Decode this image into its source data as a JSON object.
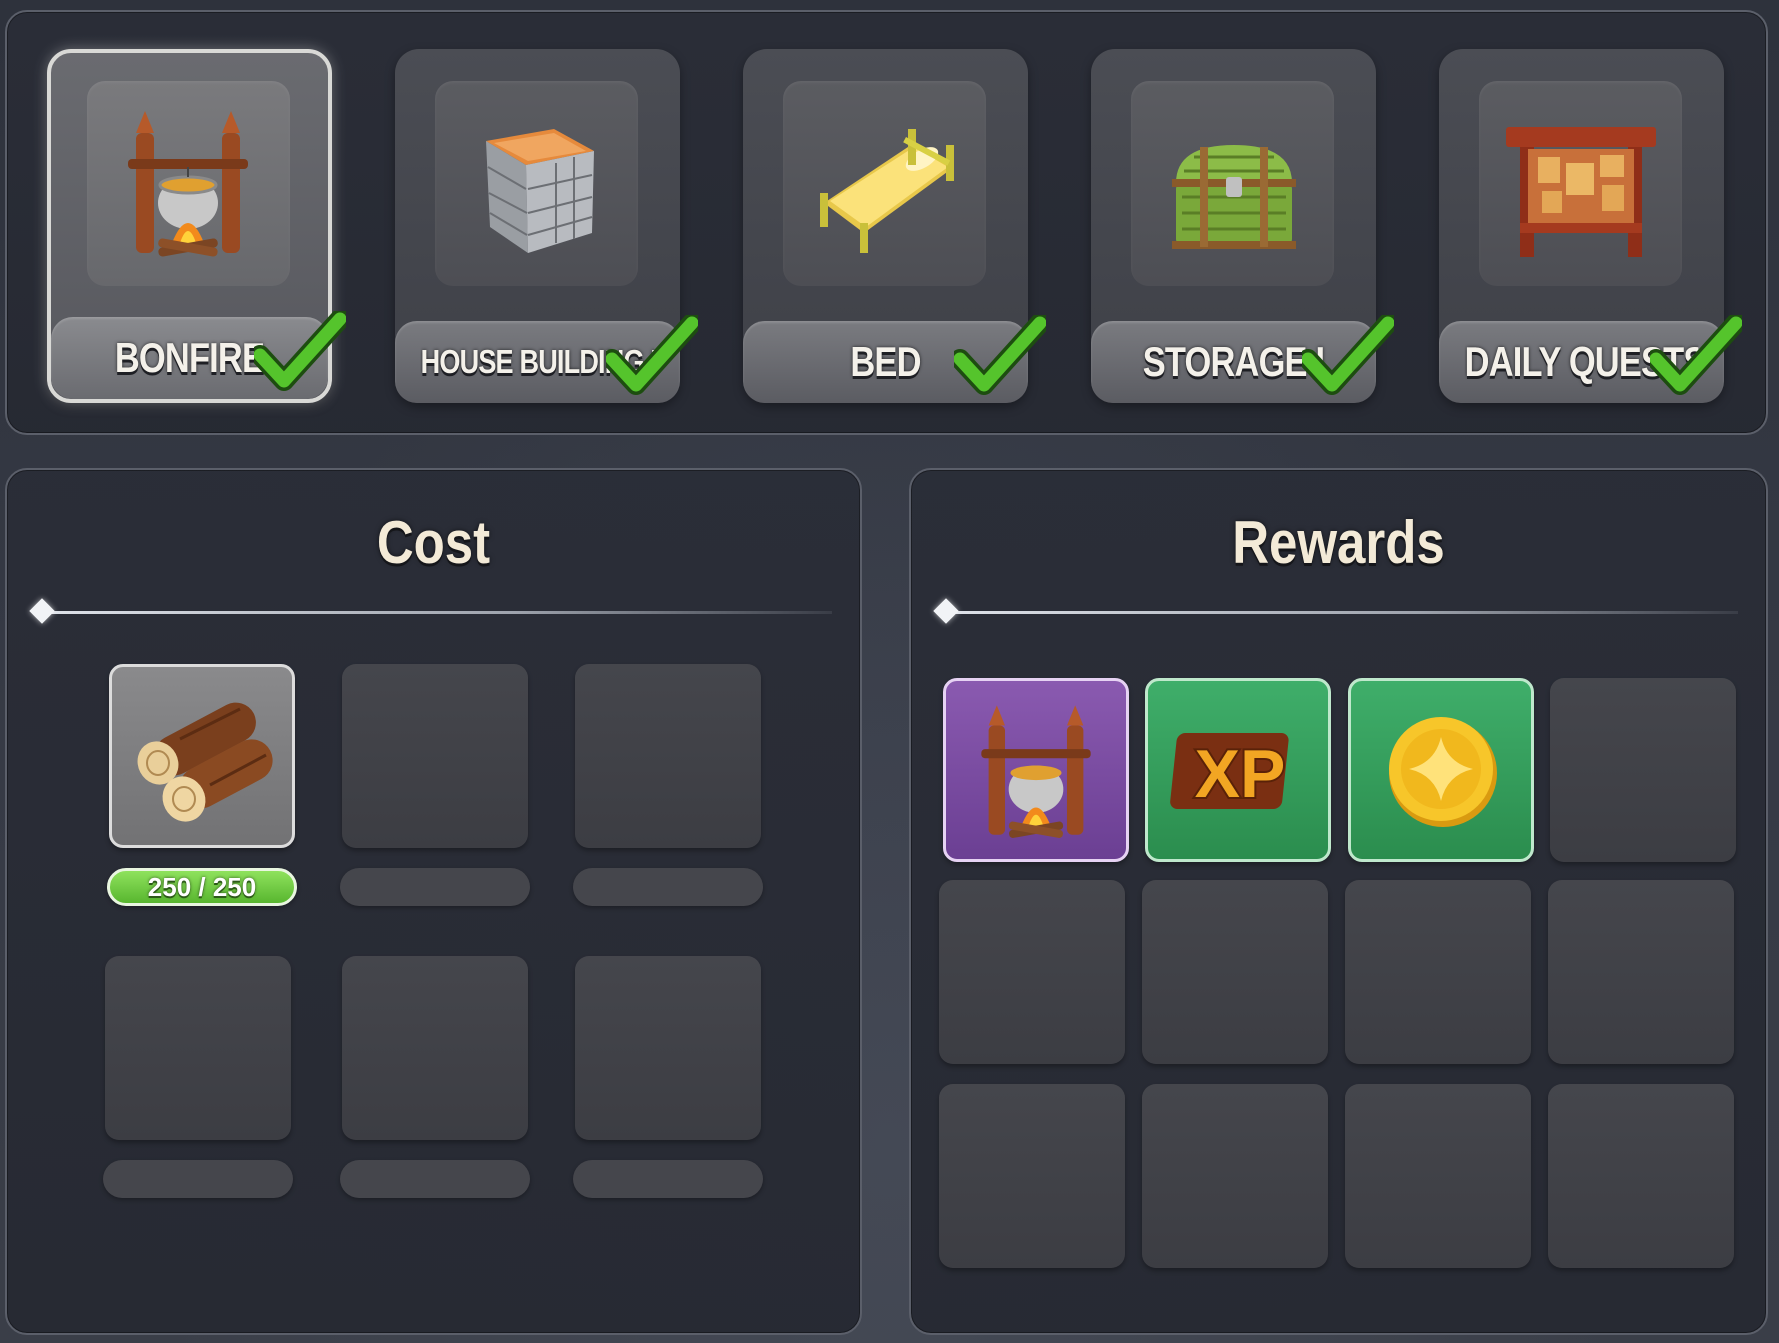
{
  "buildings": [
    {
      "label": "BONFIRE",
      "icon": "bonfire-icon",
      "selected": true,
      "completed": true
    },
    {
      "label": "HOUSE BUILDING I",
      "icon": "house-block-icon",
      "selected": false,
      "completed": true
    },
    {
      "label": "BED",
      "icon": "bed-icon",
      "selected": false,
      "completed": true
    },
    {
      "label": "STORAGE I",
      "icon": "treasure-chest-icon",
      "selected": false,
      "completed": true
    },
    {
      "label": "DAILY QUESTS",
      "icon": "quest-board-icon",
      "selected": false,
      "completed": true
    }
  ],
  "cost": {
    "title": "Cost",
    "items": [
      {
        "icon": "wood-logs-icon",
        "amount": "250 / 250",
        "have": 250,
        "need": 250
      }
    ],
    "empty_slots": 5
  },
  "rewards": {
    "title": "Rewards",
    "items": [
      {
        "icon": "bonfire-icon",
        "rarity": "purple"
      },
      {
        "icon": "xp-icon",
        "text": "XP",
        "rarity": "green"
      },
      {
        "icon": "gold-coin-icon",
        "rarity": "green"
      }
    ],
    "empty_slots": 9
  },
  "colors": {
    "checkmark": "#4fbf2a",
    "amount_bar": "#6ccb3f",
    "reward_purple": "#7a4aa3",
    "reward_green": "#339c5b",
    "title_text": "#f3ead7"
  }
}
